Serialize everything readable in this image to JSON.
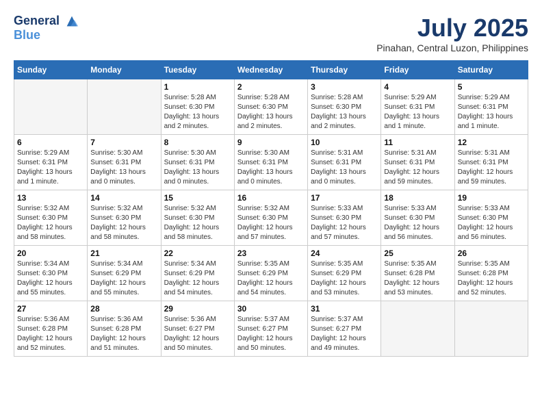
{
  "header": {
    "logo_line1": "General",
    "logo_line2": "Blue",
    "month": "July 2025",
    "location": "Pinahan, Central Luzon, Philippines"
  },
  "weekdays": [
    "Sunday",
    "Monday",
    "Tuesday",
    "Wednesday",
    "Thursday",
    "Friday",
    "Saturday"
  ],
  "weeks": [
    [
      {
        "day": "",
        "info": ""
      },
      {
        "day": "",
        "info": ""
      },
      {
        "day": "1",
        "info": "Sunrise: 5:28 AM\nSunset: 6:30 PM\nDaylight: 13 hours\nand 2 minutes."
      },
      {
        "day": "2",
        "info": "Sunrise: 5:28 AM\nSunset: 6:30 PM\nDaylight: 13 hours\nand 2 minutes."
      },
      {
        "day": "3",
        "info": "Sunrise: 5:28 AM\nSunset: 6:30 PM\nDaylight: 13 hours\nand 2 minutes."
      },
      {
        "day": "4",
        "info": "Sunrise: 5:29 AM\nSunset: 6:31 PM\nDaylight: 13 hours\nand 1 minute."
      },
      {
        "day": "5",
        "info": "Sunrise: 5:29 AM\nSunset: 6:31 PM\nDaylight: 13 hours\nand 1 minute."
      }
    ],
    [
      {
        "day": "6",
        "info": "Sunrise: 5:29 AM\nSunset: 6:31 PM\nDaylight: 13 hours\nand 1 minute."
      },
      {
        "day": "7",
        "info": "Sunrise: 5:30 AM\nSunset: 6:31 PM\nDaylight: 13 hours\nand 0 minutes."
      },
      {
        "day": "8",
        "info": "Sunrise: 5:30 AM\nSunset: 6:31 PM\nDaylight: 13 hours\nand 0 minutes."
      },
      {
        "day": "9",
        "info": "Sunrise: 5:30 AM\nSunset: 6:31 PM\nDaylight: 13 hours\nand 0 minutes."
      },
      {
        "day": "10",
        "info": "Sunrise: 5:31 AM\nSunset: 6:31 PM\nDaylight: 13 hours\nand 0 minutes."
      },
      {
        "day": "11",
        "info": "Sunrise: 5:31 AM\nSunset: 6:31 PM\nDaylight: 12 hours\nand 59 minutes."
      },
      {
        "day": "12",
        "info": "Sunrise: 5:31 AM\nSunset: 6:31 PM\nDaylight: 12 hours\nand 59 minutes."
      }
    ],
    [
      {
        "day": "13",
        "info": "Sunrise: 5:32 AM\nSunset: 6:30 PM\nDaylight: 12 hours\nand 58 minutes."
      },
      {
        "day": "14",
        "info": "Sunrise: 5:32 AM\nSunset: 6:30 PM\nDaylight: 12 hours\nand 58 minutes."
      },
      {
        "day": "15",
        "info": "Sunrise: 5:32 AM\nSunset: 6:30 PM\nDaylight: 12 hours\nand 58 minutes."
      },
      {
        "day": "16",
        "info": "Sunrise: 5:32 AM\nSunset: 6:30 PM\nDaylight: 12 hours\nand 57 minutes."
      },
      {
        "day": "17",
        "info": "Sunrise: 5:33 AM\nSunset: 6:30 PM\nDaylight: 12 hours\nand 57 minutes."
      },
      {
        "day": "18",
        "info": "Sunrise: 5:33 AM\nSunset: 6:30 PM\nDaylight: 12 hours\nand 56 minutes."
      },
      {
        "day": "19",
        "info": "Sunrise: 5:33 AM\nSunset: 6:30 PM\nDaylight: 12 hours\nand 56 minutes."
      }
    ],
    [
      {
        "day": "20",
        "info": "Sunrise: 5:34 AM\nSunset: 6:30 PM\nDaylight: 12 hours\nand 55 minutes."
      },
      {
        "day": "21",
        "info": "Sunrise: 5:34 AM\nSunset: 6:29 PM\nDaylight: 12 hours\nand 55 minutes."
      },
      {
        "day": "22",
        "info": "Sunrise: 5:34 AM\nSunset: 6:29 PM\nDaylight: 12 hours\nand 54 minutes."
      },
      {
        "day": "23",
        "info": "Sunrise: 5:35 AM\nSunset: 6:29 PM\nDaylight: 12 hours\nand 54 minutes."
      },
      {
        "day": "24",
        "info": "Sunrise: 5:35 AM\nSunset: 6:29 PM\nDaylight: 12 hours\nand 53 minutes."
      },
      {
        "day": "25",
        "info": "Sunrise: 5:35 AM\nSunset: 6:28 PM\nDaylight: 12 hours\nand 53 minutes."
      },
      {
        "day": "26",
        "info": "Sunrise: 5:35 AM\nSunset: 6:28 PM\nDaylight: 12 hours\nand 52 minutes."
      }
    ],
    [
      {
        "day": "27",
        "info": "Sunrise: 5:36 AM\nSunset: 6:28 PM\nDaylight: 12 hours\nand 52 minutes."
      },
      {
        "day": "28",
        "info": "Sunrise: 5:36 AM\nSunset: 6:28 PM\nDaylight: 12 hours\nand 51 minutes."
      },
      {
        "day": "29",
        "info": "Sunrise: 5:36 AM\nSunset: 6:27 PM\nDaylight: 12 hours\nand 50 minutes."
      },
      {
        "day": "30",
        "info": "Sunrise: 5:37 AM\nSunset: 6:27 PM\nDaylight: 12 hours\nand 50 minutes."
      },
      {
        "day": "31",
        "info": "Sunrise: 5:37 AM\nSunset: 6:27 PM\nDaylight: 12 hours\nand 49 minutes."
      },
      {
        "day": "",
        "info": ""
      },
      {
        "day": "",
        "info": ""
      }
    ]
  ]
}
